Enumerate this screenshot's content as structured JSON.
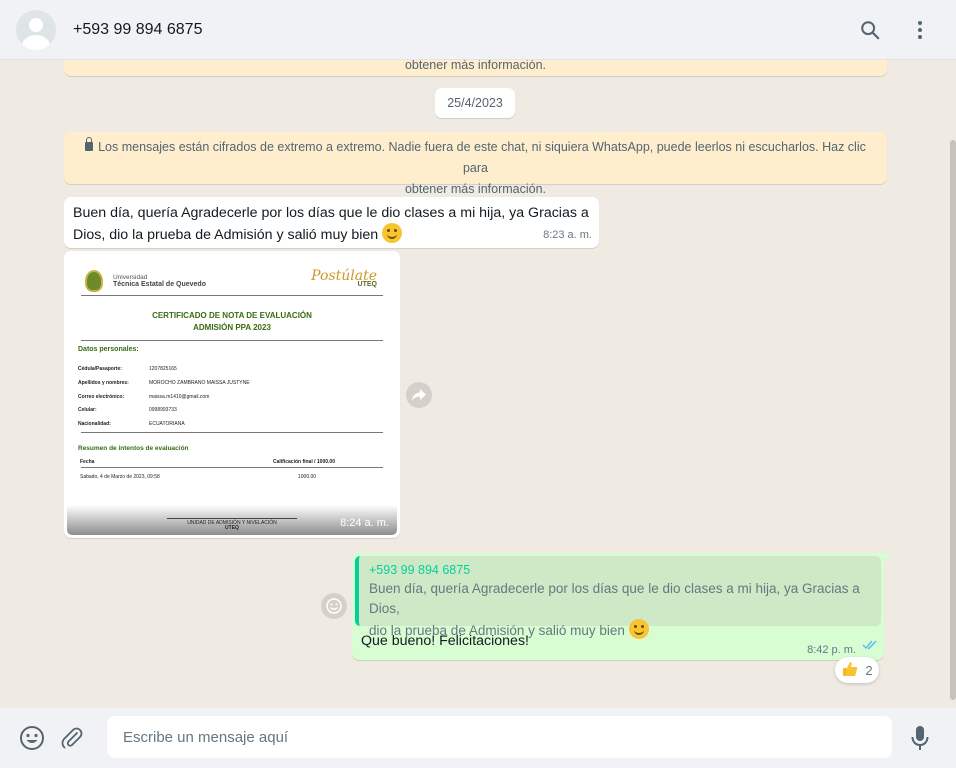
{
  "header": {
    "contact_name": "+593 99 894 6875",
    "icons": [
      "avatar",
      "search-icon",
      "menu-icon"
    ]
  },
  "chat": {
    "top_notice_partial": "obtener más información.",
    "date": "25/4/2023",
    "encryption_notice_line1": "Los mensajes están cifrados de extremo a extremo. Nadie fuera de este chat, ni siquiera WhatsApp, puede leerlos ni escucharlos. Haz clic para",
    "encryption_notice_line2": "obtener más información.",
    "messages": [
      {
        "type": "incoming-text",
        "text_line1": "Buen día, quería Agradecerle por los días que le dio clases a mi hija, ya Gracias a",
        "text_line2": "Dios, dio la prueba de Admisión y salió muy bien",
        "emoji": "smiling-face",
        "time": "8:23 a. m."
      },
      {
        "type": "incoming-image",
        "time": "8:24 a. m.",
        "image": {
          "uni_line1": "Universidad",
          "uni_line2": "Técnica Estatal de Quevedo",
          "brand": "Postúlate",
          "brand_sub": "UTEQ",
          "title_line1": "CERTIFICADO DE NOTA DE EVALUACIÓN",
          "title_line2": "ADMISIÓN PPA 2023",
          "section_personal": "Datos personales:",
          "rows": [
            {
              "k": "Cédula/Pasaporte:",
              "v": "1207825165"
            },
            {
              "k": "Apellidos y nombres:",
              "v": "MOROCHO ZAMBRANO MAISSA JUSTYNE"
            },
            {
              "k": "Correo electrónico:",
              "v": "maissa.m1410@gmail.com"
            },
            {
              "k": "Celular:",
              "v": "0998993733"
            },
            {
              "k": "Nacionalidad:",
              "v": "ECUATORIANA"
            }
          ],
          "section_summary": "Resumen de intentos de evaluación",
          "col_date": "Fecha",
          "col_grade": "Calificación final / 1000.00",
          "attempt_date": "Sabado, 4 de Marzo de 2023, 09:58",
          "attempt_grade": "1000.00",
          "footer_line1": "UNIDAD DE ADMISIÓN Y NIVELACIÓN",
          "footer_line2": "UTEQ"
        }
      },
      {
        "type": "outgoing-reply",
        "quote_author": "+593 99 894 6875",
        "quote_line1": "Buen día, quería Agradecerle por los días que le dio clases a mi hija, ya Gracias a Dios,",
        "quote_line2": "dio la prueba de Admisión y salió muy bien",
        "text": "Que bueno! Felicitaciones!",
        "time": "8:42 p. m.",
        "status": "read",
        "reaction_emoji": "thumbs-up",
        "reaction_count": "2"
      }
    ]
  },
  "footer": {
    "placeholder": "Escribe un mensaje aquí",
    "icons": [
      "emoji-icon",
      "attach-icon",
      "mic-icon"
    ]
  },
  "colors": {
    "outgoing": "#d9fdd3",
    "system": "#ffeecd",
    "accent": "#06cf9c",
    "read_tick": "#53bdeb"
  }
}
